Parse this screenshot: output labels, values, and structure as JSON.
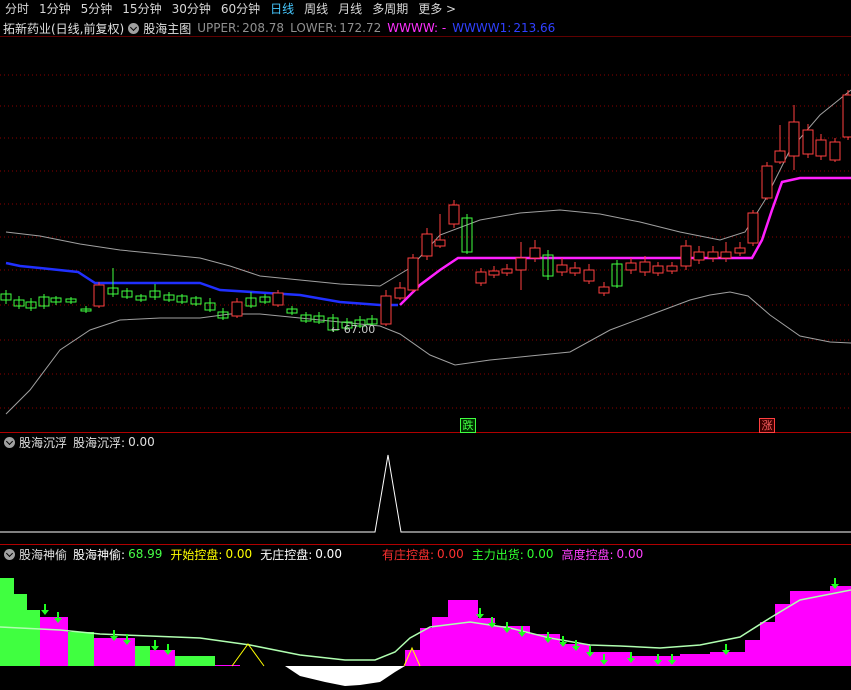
{
  "toolbar": {
    "items": [
      "分时",
      "1分钟",
      "5分钟",
      "15分钟",
      "30分钟",
      "60分钟",
      "日线",
      "周线",
      "月线",
      "多周期",
      "更多"
    ],
    "active_label": "日线",
    "more_arrow": ">"
  },
  "main_panel": {
    "stock_title": "拓新药业(日线,前复权)",
    "indicator_name": "股海主图",
    "upper_label": "UPPER:",
    "upper_value": "208.78",
    "lower_label": "LOWER:",
    "lower_value": "172.72",
    "wwww_label": "WWWW: -",
    "wwww1_label": "WWWW1:",
    "wwww1_value": "213.66",
    "low_price_label": "← 67.00",
    "signal_fall": "跌",
    "signal_rise": "涨"
  },
  "panel2": {
    "indicator_name": "股海沉浮",
    "value_label": "股海沉浮:",
    "value": "0.00"
  },
  "panel3": {
    "indicator_name": "股海神偷",
    "items": [
      {
        "label": "股海神偷:",
        "value": "68.99",
        "color": "#ffffff",
        "value_color": "#46ff46"
      },
      {
        "label": "开始控盘:",
        "value": "0.00",
        "color": "#ffff00",
        "value_color": "#ffff00"
      },
      {
        "label": "无庄控盘:",
        "value": "0.00",
        "color": "#ffffff",
        "value_color": "#ffffff"
      },
      {
        "label": "有庄控盘:",
        "value": "0.00",
        "color": "#ff3030",
        "value_color": "#ff3030"
      },
      {
        "label": "主力出货:",
        "value": "0.00",
        "color": "#30ff30",
        "value_color": "#30ff30"
      },
      {
        "label": "高度控盘:",
        "value": "0.00",
        "color": "#ff40ff",
        "value_color": "#ff40ff"
      }
    ]
  },
  "colors": {
    "up": "#ff4040",
    "down": "#40ff40",
    "band": "#a0a0a0",
    "blue_line": "#2030ff",
    "magenta_line": "#ff20ff",
    "active_tab": "#46c8ff"
  },
  "chart_data": {
    "type": "candlestick",
    "title": "拓新药业(日线,前复权)",
    "upper": 208.78,
    "lower": 172.72,
    "wwww1": 213.66,
    "marked_low": 67.0,
    "panel2_series": "股海沉浮",
    "panel2_value": 0.0,
    "panel3_series": "股海神偷",
    "panel3_value": 68.99
  }
}
